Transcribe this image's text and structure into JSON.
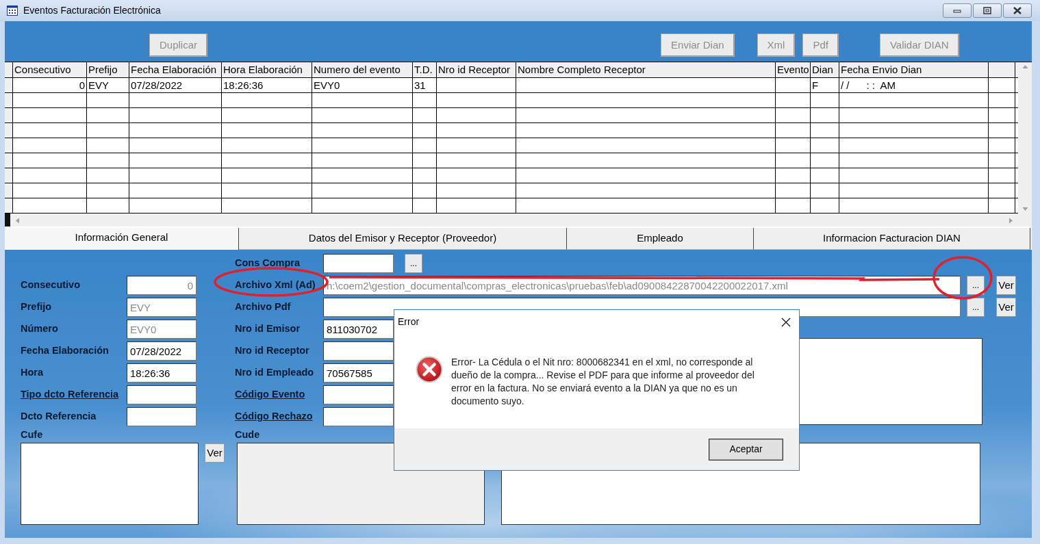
{
  "window": {
    "title": "Eventos Facturación Electrónica"
  },
  "toolbar": [
    {
      "label": "Duplicar",
      "disabled": true
    },
    {
      "label": "Enviar Dian",
      "disabled": true
    },
    {
      "label": "Xml",
      "disabled": true
    },
    {
      "label": "Pdf",
      "disabled": true
    },
    {
      "label": "Validar DIAN",
      "disabled": true
    }
  ],
  "table": {
    "columns": [
      "Consecutivo",
      "Prefijo",
      "Fecha Elaboración",
      "Hora Elaboración",
      "Numero del evento",
      "T.D.",
      "Nro id Receptor",
      "Nombre Completo Receptor",
      "Evento",
      "Dian",
      "Fecha Envio Dian"
    ],
    "rows": [
      {
        "cells": [
          "0",
          "EVY",
          "07/28/2022",
          "18:26:36",
          "EVY0",
          "31",
          null,
          null,
          null,
          "F",
          "/ /      : :  AM"
        ]
      }
    ]
  },
  "tabs": [
    {
      "label": "Información General",
      "selected": true
    },
    {
      "label": "Datos del Emisor y Receptor (Proveedor)",
      "selected": false
    },
    {
      "label": "Empleado",
      "selected": false
    },
    {
      "label": "Informacion Facturacion DIAN",
      "selected": false
    }
  ],
  "form": {
    "cons_compra": {
      "label": "Cons Compra",
      "browse": "..."
    },
    "left_fields": [
      {
        "label": "Consecutivo",
        "value": "0",
        "disabled": true,
        "link": false
      },
      {
        "label": "Prefijo",
        "value": "EVY",
        "disabled": true,
        "link": false
      },
      {
        "label": "Número",
        "value": "EVY0",
        "disabled": true,
        "link": false
      },
      {
        "label": "Fecha Elaboración",
        "value": "07/28/2022",
        "disabled": false,
        "link": false
      },
      {
        "label": "Hora",
        "value": "18:26:36",
        "disabled": false,
        "link": false
      },
      {
        "label": "Tipo dcto Referencia",
        "link": true
      },
      {
        "label": "Dcto Referencia",
        "link": false
      }
    ],
    "xml": {
      "label": "Archivo Xml (Ad)",
      "value": "h:\\coem2\\gestion_documental\\compras_electronicas\\pruebas\\feb\\ad09008422870042200022017.xml",
      "disabled": true,
      "browse": "...",
      "view": "Ver"
    },
    "pdf": {
      "label": "Archivo Pdf",
      "browse": "...",
      "view": "Ver"
    },
    "mid_fields": [
      {
        "label": "Nro id Emisor",
        "value": "811030702",
        "link": false
      },
      {
        "label": "Nro id Receptor",
        "link": false
      },
      {
        "label": "Nro id Empleado",
        "value": "70567585",
        "link": false
      },
      {
        "label": "Código Evento",
        "link": true
      },
      {
        "label": "Código Rechazo",
        "link": true
      }
    ],
    "cufe": {
      "label": "Cufe",
      "view": "Ver"
    },
    "cude": {
      "label": "Cude",
      "disabled": true
    }
  },
  "dialog": {
    "title": "Error",
    "message": "Error- La Cédula o el Nit nro: 8000682341 en el xml, no corresponde al dueño de la compra... Revise el PDF para que informe al proveedor del error en la factura. No se enviará evento a la DIAN ya que no es un documento suyo.",
    "button": "Aceptar"
  }
}
